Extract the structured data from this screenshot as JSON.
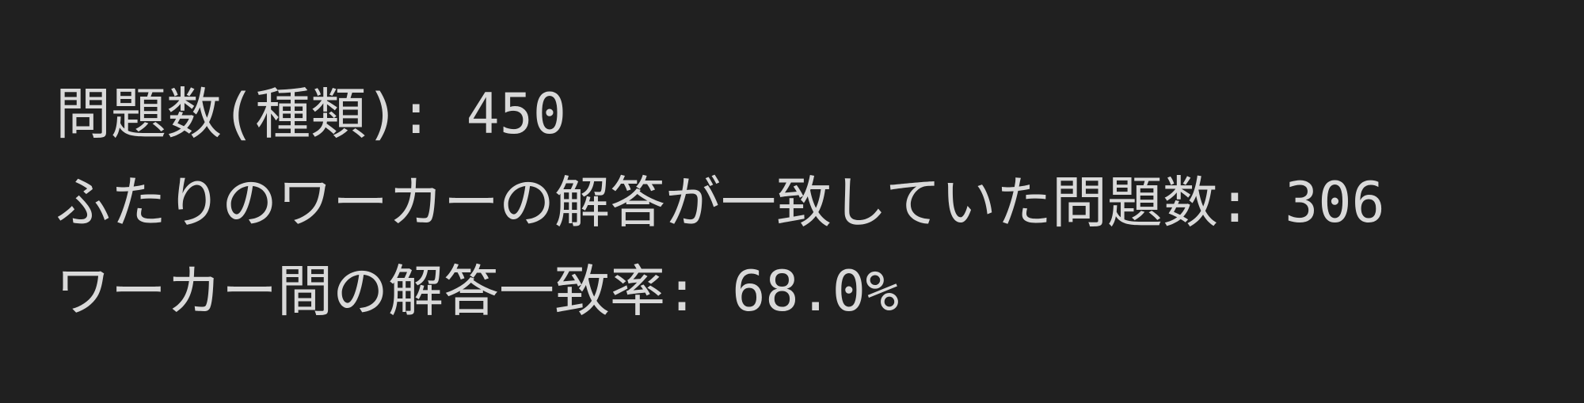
{
  "output": {
    "lines": [
      "問題数(種類): 450",
      "ふたりのワーカーの解答が一致していた問題数: 306",
      "ワーカー間の解答一致率: 68.0%"
    ]
  },
  "colors": {
    "background": "#202020",
    "text": "#d9d9d9"
  }
}
